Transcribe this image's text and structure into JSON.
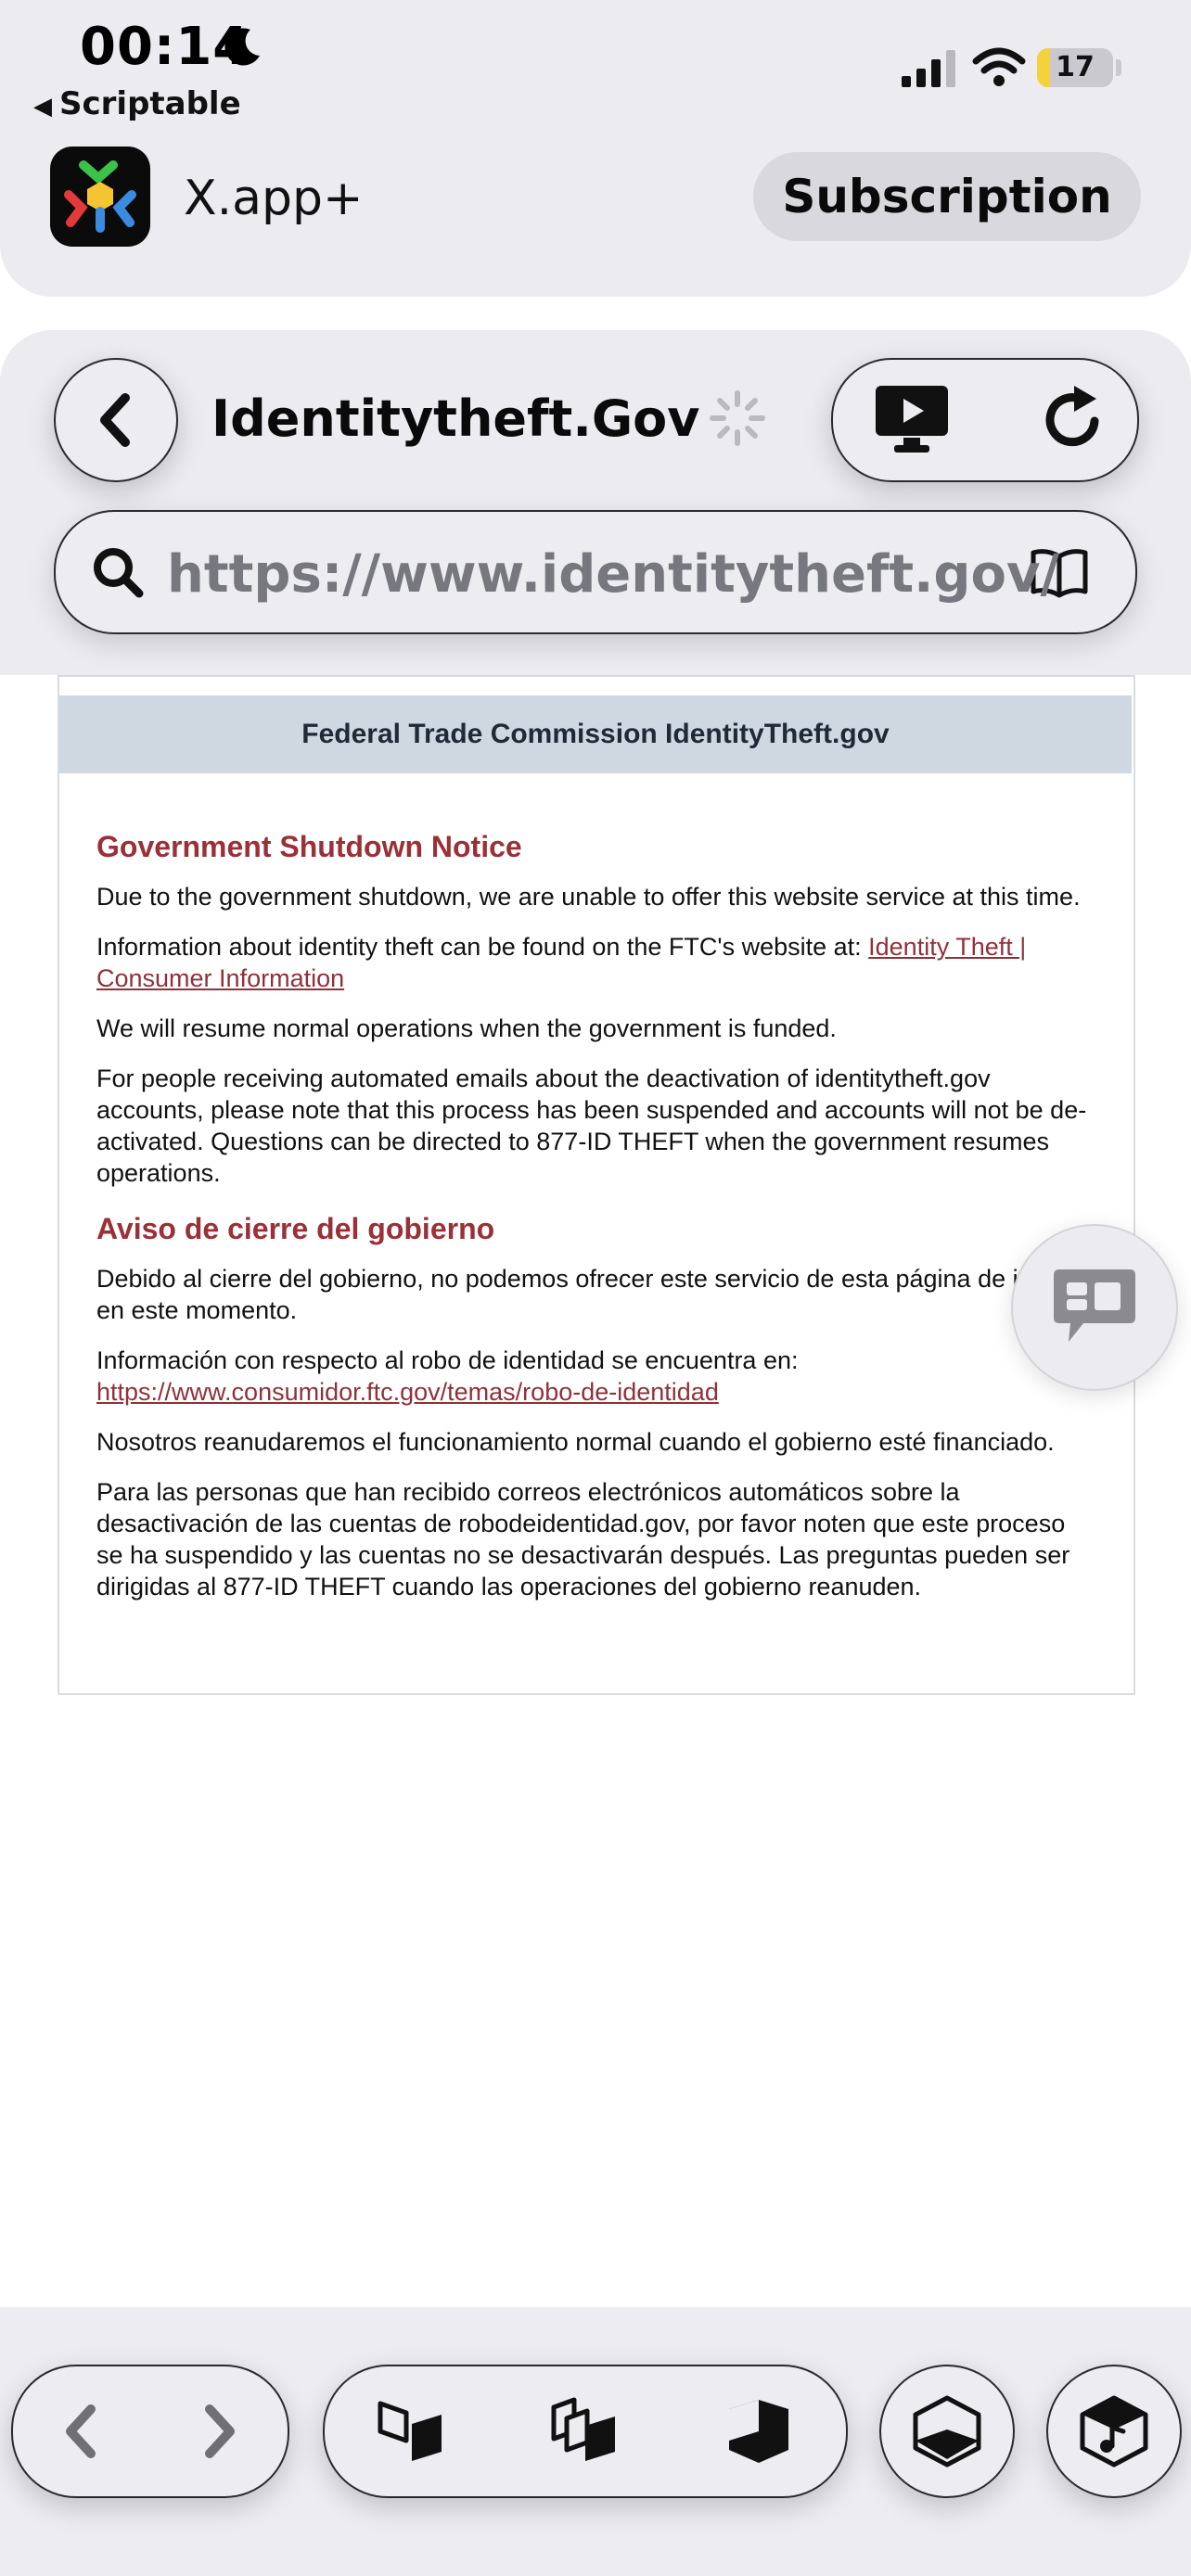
{
  "status_bar": {
    "time": "00:14",
    "back_app_label": "Scriptable",
    "battery_level": "17"
  },
  "app_header": {
    "app_name": "X.app+",
    "subscription_label": "Subscription"
  },
  "browser": {
    "page_title": "Identitytheft.Gov",
    "url": "https://www.identitytheft.gov/"
  },
  "web_page": {
    "banner": "Federal Trade Commission IdentityTheft.gov",
    "english": {
      "heading": "Government Shutdown Notice",
      "p1": "Due to the government shutdown, we are unable to offer this website service at this time.",
      "p2_prefix": "Information about identity theft can be found on the FTC's website at: ",
      "p2_link": "Identity Theft | Consumer Information",
      "p3": "We will resume normal operations when the government is funded.",
      "p4": "For people receiving automated emails about the deactivation of identitytheft.gov accounts, please note that this process has been suspended and accounts will not be de-activated. Questions can be directed to 877-ID THEFT when the government resumes operations."
    },
    "spanish": {
      "heading": "Aviso de cierre del gobierno",
      "p1": "Debido al cierre del gobierno, no podemos ofrecer este servicio de esta página de internet en este momento.",
      "p2_prefix": "Información con respecto al robo de identidad se encuentra en:",
      "p2_link": "https://www.consumidor.ftc.gov/temas/robo-de-identidad",
      "p3": "Nosotros reanudaremos el funcionamiento normal cuando el gobierno esté financiado.",
      "p4": "Para las personas que han recibido correos electrónicos automáticos sobre la desactivación de las cuentas de robodeidentidad.gov, por favor noten que este proceso se ha suspendido y las cuentas no se desactivarán después. Las preguntas pueden ser dirigidas al 877-ID THEFT cuando las operaciones del gobierno reanuden."
    }
  },
  "icons": {
    "moon": "moon-icon",
    "signal": "cellular-signal-icon",
    "wifi": "wifi-icon",
    "back": "chevron-left-icon",
    "loading": "spinner-icon",
    "screen": "tv-play-icon",
    "reload": "reload-icon",
    "search": "search-icon",
    "reader": "book-icon",
    "chat": "chat-bubble-icon"
  },
  "colors": {
    "accent_red": "#9a3038",
    "banner_bg": "#cfd8e1",
    "battery_fill": "#f4d23c"
  }
}
